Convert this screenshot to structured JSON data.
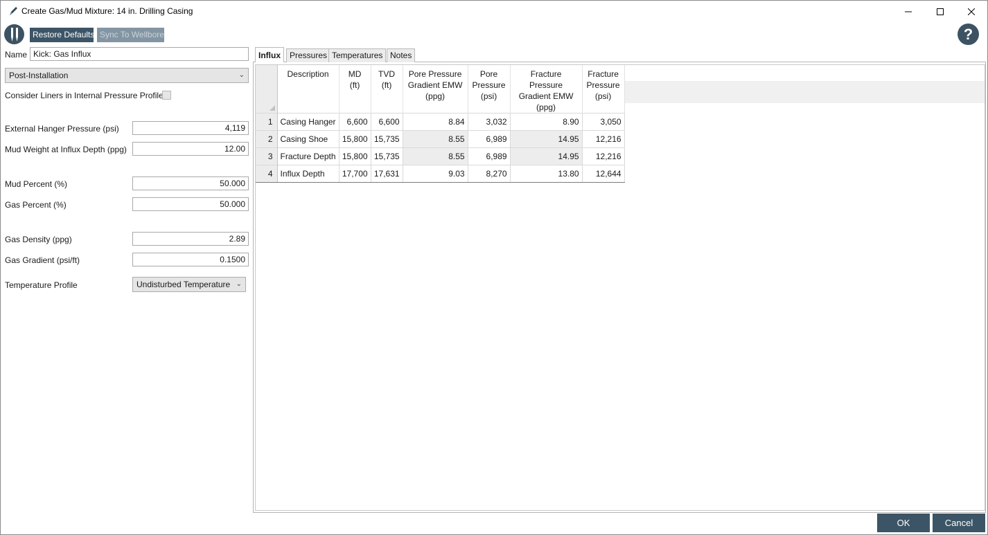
{
  "window": {
    "title": "Create Gas/Mud Mixture: 14 in. Drilling Casing",
    "min_icon": "minimize-icon",
    "max_icon": "maximize-icon",
    "close_icon": "close-icon"
  },
  "toolbar": {
    "restore_defaults": "Restore Defaults",
    "sync_to_wellbore": "Sync To Wellbore",
    "help_icon_glyph": "?"
  },
  "form": {
    "name_label": "Name",
    "name_value": "Kick: Gas Influx",
    "phase_value": "Post-Installation",
    "consider_liners_label": "Consider Liners in Internal Pressure Profile",
    "external_hanger_label": "External Hanger Pressure (psi)",
    "external_hanger_value": "4,119",
    "mud_weight_label": "Mud Weight at Influx Depth (ppg)",
    "mud_weight_value": "12.00",
    "mud_percent_label": "Mud Percent (%)",
    "mud_percent_value": "50.000",
    "gas_percent_label": "Gas Percent (%)",
    "gas_percent_value": "50.000",
    "gas_density_label": "Gas Density (ppg)",
    "gas_density_value": "2.89",
    "gas_gradient_label": "Gas Gradient (psi/ft)",
    "gas_gradient_value": "0.1500",
    "temp_profile_label": "Temperature Profile",
    "temp_profile_value": "Undisturbed Temperature"
  },
  "tabs": [
    "Influx",
    "Pressures",
    "Temperatures",
    "Notes"
  ],
  "table": {
    "headers": [
      [
        "Description"
      ],
      [
        "MD",
        "(ft)"
      ],
      [
        "TVD",
        "(ft)"
      ],
      [
        "Pore Pressure",
        "Gradient EMW",
        "(ppg)"
      ],
      [
        "Pore",
        "Pressure",
        "(psi)"
      ],
      [
        "Fracture Pressure",
        "Gradient EMW",
        "(ppg)"
      ],
      [
        "Fracture",
        "Pressure",
        "(psi)"
      ]
    ],
    "rows": [
      [
        "1",
        "Casing Hanger",
        "6,600",
        "6,600",
        "8.84",
        "3,032",
        "8.90",
        "3,050"
      ],
      [
        "2",
        "Casing Shoe",
        "15,800",
        "15,735",
        "8.55",
        "6,989",
        "14.95",
        "12,216"
      ],
      [
        "3",
        "Fracture Depth",
        "15,800",
        "15,735",
        "8.55",
        "6,989",
        "14.95",
        "12,216"
      ],
      [
        "4",
        "Influx Depth",
        "17,700",
        "17,631",
        "9.03",
        "8,270",
        "13.80",
        "12,644"
      ]
    ]
  },
  "footer": {
    "ok": "OK",
    "cancel": "Cancel"
  },
  "colors": {
    "accent": "#3c5566",
    "disabled": "#8395a3"
  }
}
